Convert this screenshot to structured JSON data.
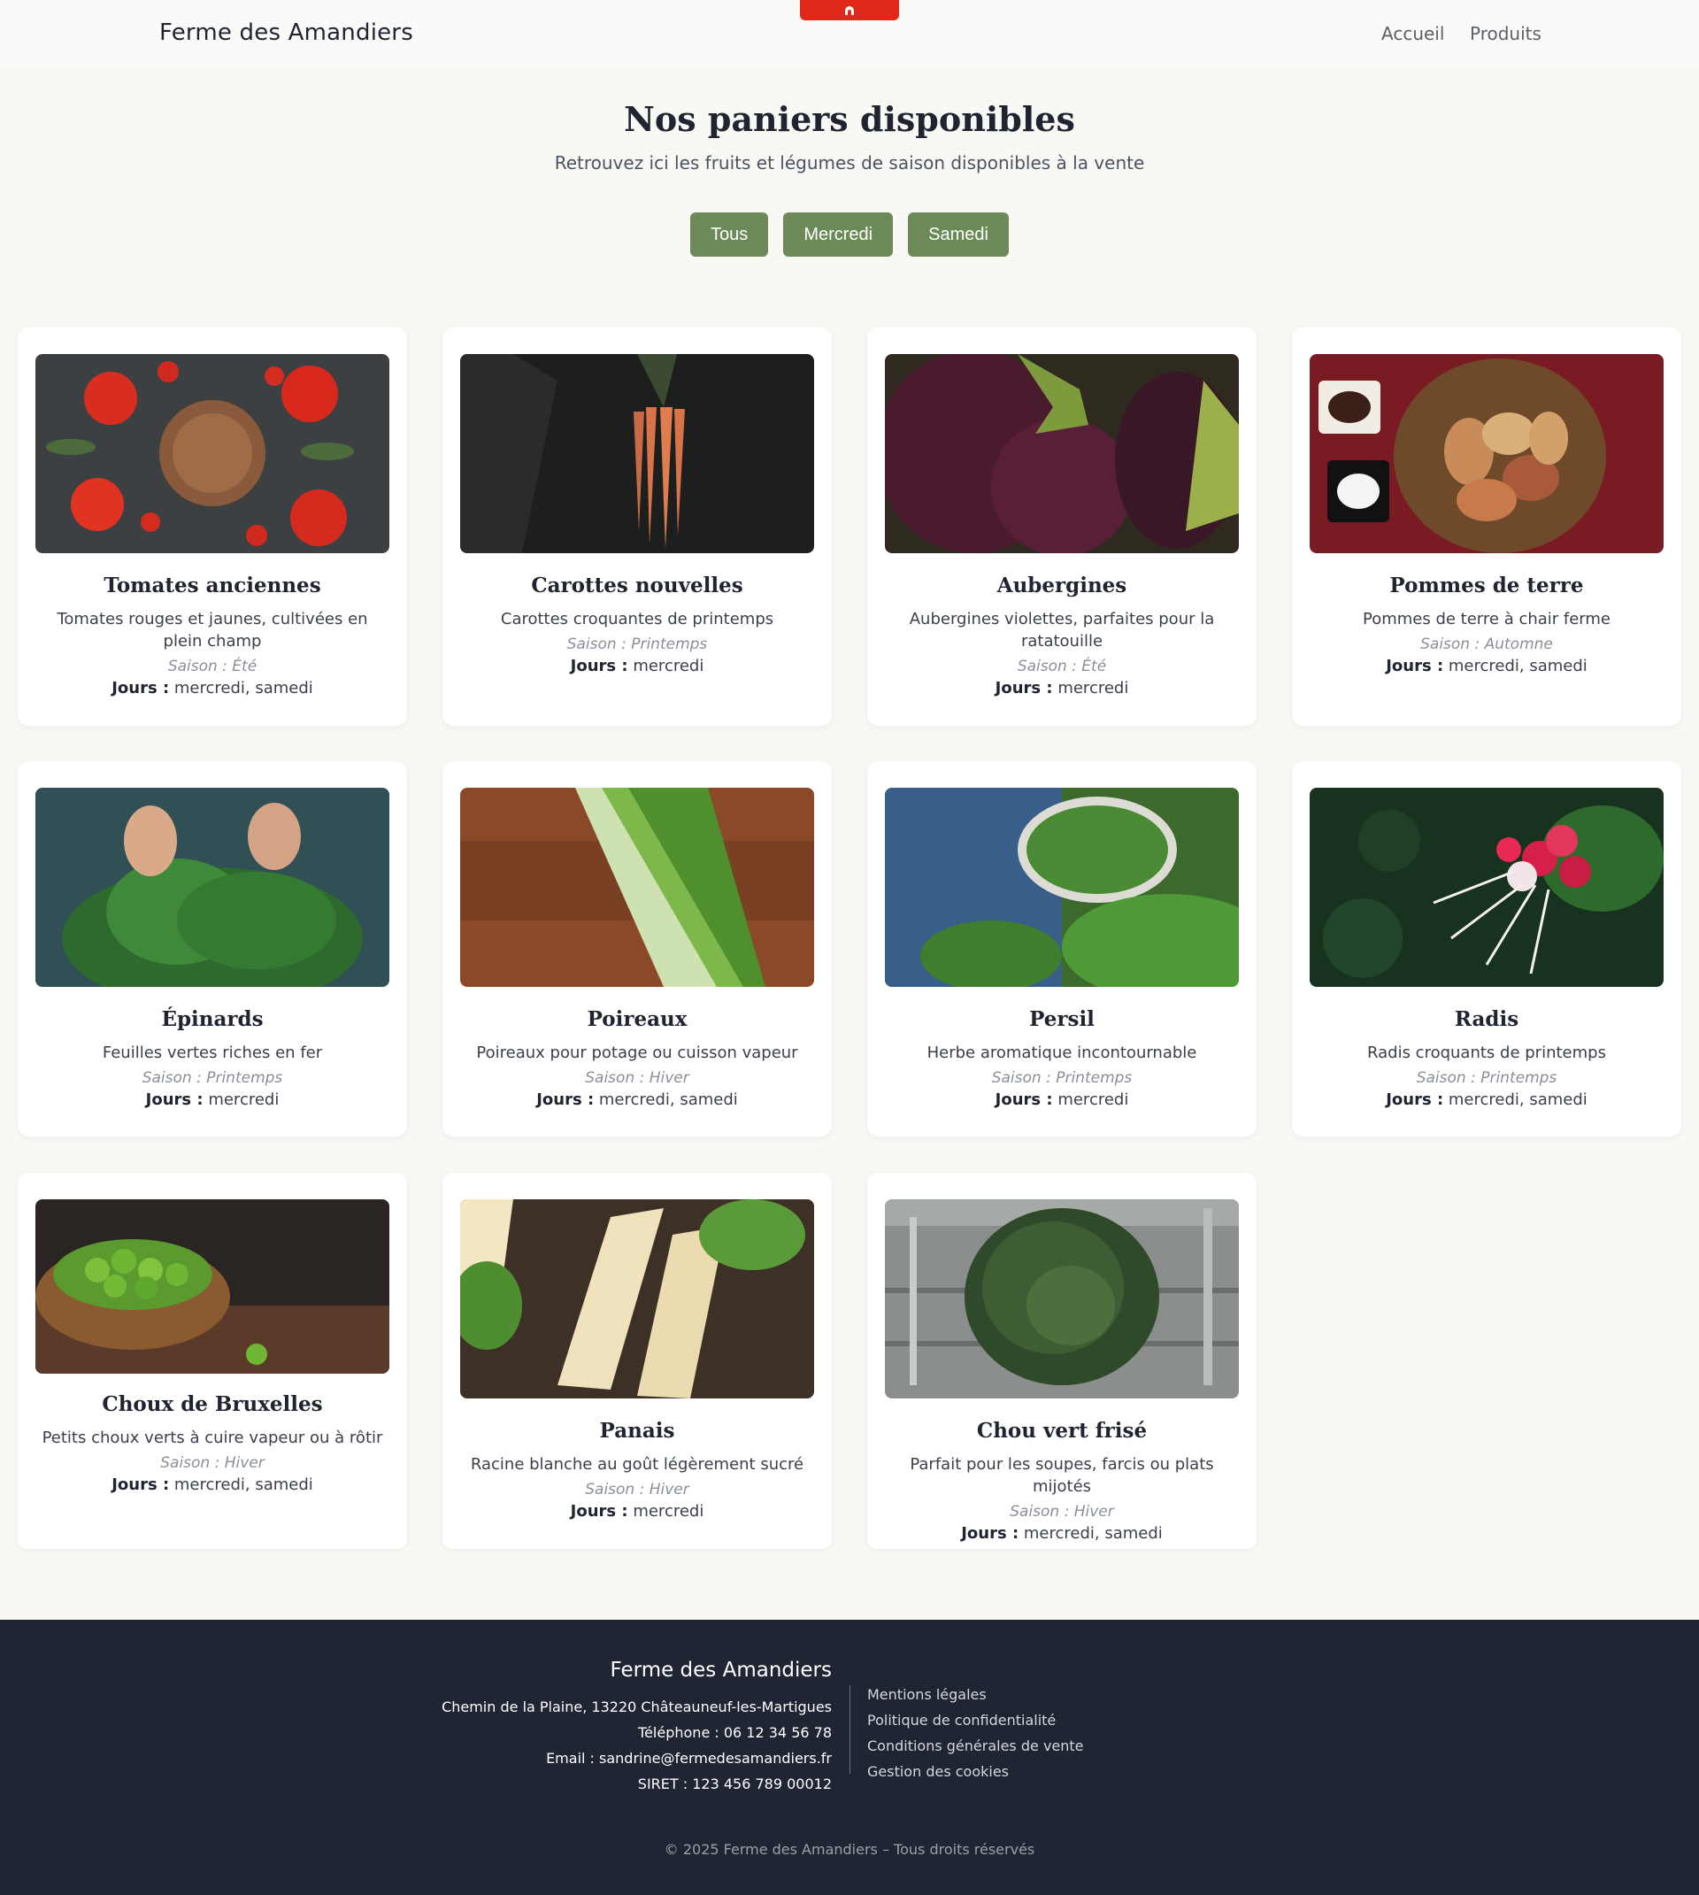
{
  "header": {
    "brand": "Ferme des Amandiers",
    "nav": {
      "home": "Accueil",
      "products": "Produits"
    }
  },
  "hero": {
    "title": "Nos paniers disponibles",
    "subtitle": "Retrouvez ici les fruits et légumes de saison disponibles à la vente"
  },
  "filters": [
    "Tous",
    "Mercredi",
    "Samedi"
  ],
  "labels": {
    "days": "Jours :"
  },
  "products": [
    {
      "name": "Tomates anciennes",
      "desc": "Tomates rouges et jaunes, cultivées en plein champ",
      "season": "Saison : Été",
      "days": "mercredi, samedi"
    },
    {
      "name": "Carottes nouvelles",
      "desc": "Carottes croquantes de printemps",
      "season": "Saison : Printemps",
      "days": "mercredi"
    },
    {
      "name": "Aubergines",
      "desc": "Aubergines violettes, parfaites pour la ratatouille",
      "season": "Saison : Été",
      "days": "mercredi"
    },
    {
      "name": "Pommes de terre",
      "desc": "Pommes de terre à chair ferme",
      "season": "Saison : Automne",
      "days": "mercredi, samedi"
    },
    {
      "name": "Épinards",
      "desc": "Feuilles vertes riches en fer",
      "season": "Saison : Printemps",
      "days": "mercredi"
    },
    {
      "name": "Poireaux",
      "desc": "Poireaux pour potage ou cuisson vapeur",
      "season": "Saison : Hiver",
      "days": "mercredi, samedi"
    },
    {
      "name": "Persil",
      "desc": "Herbe aromatique incontournable",
      "season": "Saison : Printemps",
      "days": "mercredi"
    },
    {
      "name": "Radis",
      "desc": "Radis croquants de printemps",
      "season": "Saison : Printemps",
      "days": "mercredi, samedi"
    },
    {
      "name": "Choux de Bruxelles",
      "desc": "Petits choux verts à cuire vapeur ou à rôtir",
      "season": "Saison : Hiver",
      "days": "mercredi, samedi"
    },
    {
      "name": "Panais",
      "desc": "Racine blanche au goût légèrement sucré",
      "season": "Saison : Hiver",
      "days": "mercredi"
    },
    {
      "name": "Chou vert frisé",
      "desc": "Parfait pour les soupes, farcis ou plats mijotés",
      "season": "Saison : Hiver",
      "days": "mercredi, samedi"
    }
  ],
  "footer": {
    "name": "Ferme des Amandiers",
    "address": "Chemin de la Plaine, 13220 Châteauneuf-les-Martigues",
    "phone": "Téléphone : 06 12 34 56 78",
    "email": "Email : sandrine@fermedesamandiers.fr",
    "siret": "SIRET : 123 456 789 00012",
    "links": [
      "Mentions légales",
      "Politique de confidentialité",
      "Conditions générales de vente",
      "Gestion des cookies"
    ],
    "copyright": "© 2025 Ferme des Amandiers – Tous droits réservés"
  },
  "colors": {
    "accent_green": "#6b8a57",
    "footer_bg": "#1f2533",
    "top_tab_red": "#e0281b"
  }
}
